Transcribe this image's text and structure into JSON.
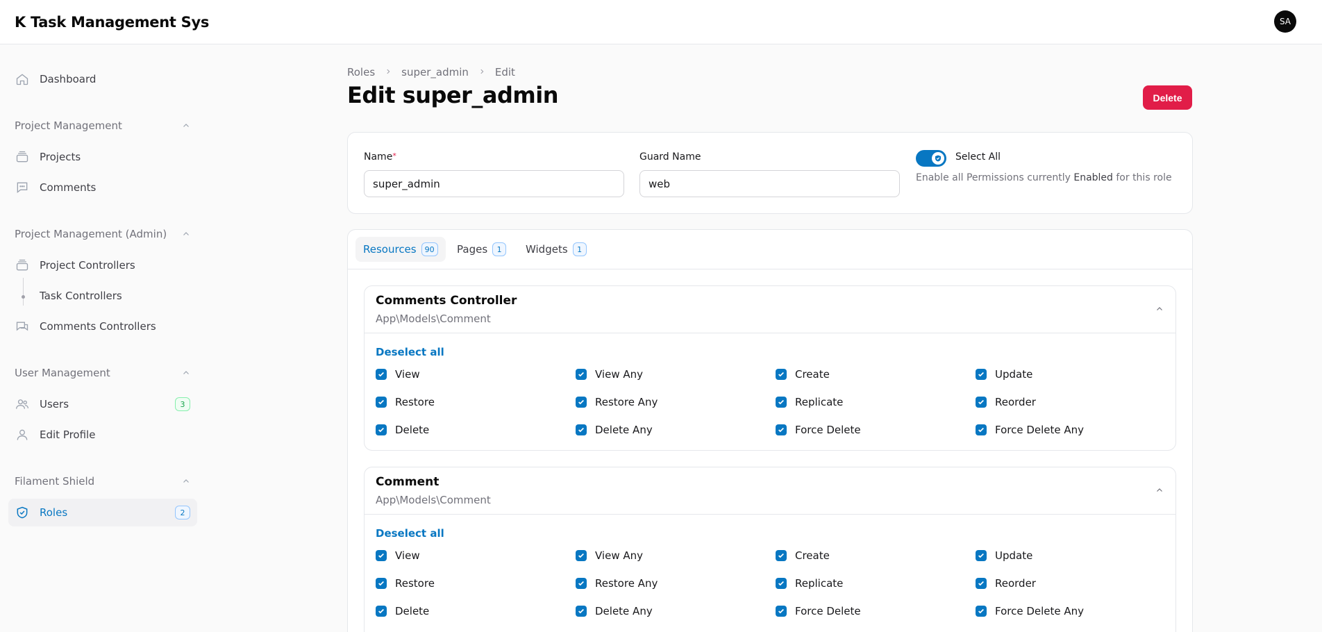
{
  "app": {
    "title": "K Task Management Sys",
    "avatar_initials": "SA"
  },
  "sidebar": {
    "dashboard": "Dashboard",
    "groups": [
      {
        "label": "Project Management",
        "items": [
          {
            "label": "Projects"
          },
          {
            "label": "Comments"
          }
        ]
      },
      {
        "label": "Project Management (Admin)",
        "items": [
          {
            "label": "Project Controllers"
          },
          {
            "label": "Task Controllers"
          },
          {
            "label": "Comments Controllers"
          }
        ]
      },
      {
        "label": "User Management",
        "items": [
          {
            "label": "Users",
            "badge": "3"
          },
          {
            "label": "Edit Profile"
          }
        ]
      },
      {
        "label": "Filament Shield",
        "items": [
          {
            "label": "Roles",
            "badge": "2"
          }
        ]
      }
    ]
  },
  "breadcrumb": [
    "Roles",
    "super_admin",
    "Edit"
  ],
  "page": {
    "title": "Edit super_admin",
    "delete_label": "Delete"
  },
  "form": {
    "name_label": "Name",
    "name_required_mark": "*",
    "name_value": "super_admin",
    "guard_label": "Guard Name",
    "guard_value": "web",
    "select_all_label": "Select All",
    "select_all_help_1": "Enable all Permissions currently ",
    "select_all_help_bold": "Enabled",
    "select_all_help_2": " for this role"
  },
  "tabs": [
    {
      "label": "Resources",
      "count": "90"
    },
    {
      "label": "Pages",
      "count": "1"
    },
    {
      "label": "Widgets",
      "count": "1"
    }
  ],
  "sections": [
    {
      "title": "Comments Controller",
      "subtitle": "App\\Models\\Comment",
      "deselect_label": "Deselect all",
      "permissions": [
        "View",
        "View Any",
        "Create",
        "Update",
        "Restore",
        "Restore Any",
        "Replicate",
        "Reorder",
        "Delete",
        "Delete Any",
        "Force Delete",
        "Force Delete Any"
      ]
    },
    {
      "title": "Comment",
      "subtitle": "App\\Models\\Comment",
      "deselect_label": "Deselect all",
      "permissions": [
        "View",
        "View Any",
        "Create",
        "Update",
        "Restore",
        "Restore Any",
        "Replicate",
        "Reorder",
        "Delete",
        "Delete Any",
        "Force Delete",
        "Force Delete Any"
      ]
    }
  ],
  "colors": {
    "primary": "#0877c2",
    "danger": "#e11d48",
    "success": "#16a34a"
  }
}
